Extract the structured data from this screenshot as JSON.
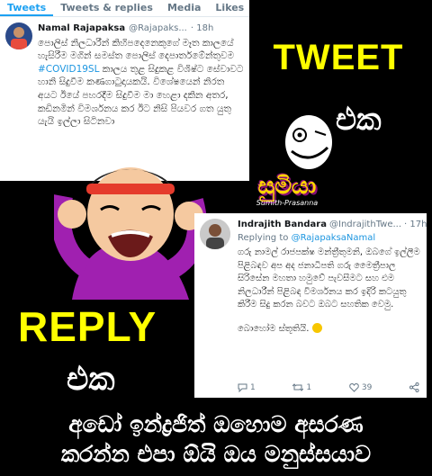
{
  "tweet": {
    "tabs": [
      "Tweets",
      "Tweets & replies",
      "Media",
      "Likes"
    ],
    "name": "Namal Rajapaksa",
    "handle": "@Rajapaks...",
    "time": "· 18h",
    "text_before": "පොලිස් නිලධාරීන් කිහිපදෙනෙකුගේ මෑත කාලයේ හැසිරීම මගින් සමස්ත පොලිස් දෙපාර්තමේන්තුවම ",
    "hashtag": "#COVID19SL",
    "text_after": " කාලය තුළ සිදුකළ විශිෂ්ට සේවාවට හානි සිදුවීම කණගාටුදායකයි. විශේෂයෙන් නිරත අයට ඊයේ පහරදීම සිදුවීම මා හෙළා දකින අතර, කඩිනමින් විමර්ශනය කර ඊට නිසි පියවර ගත යුතු යැයි ඉල්ලා සිටිනවා"
  },
  "labels": {
    "tweet_big": "TWEET",
    "eka_top": "එක",
    "badge_main": "සුමියා",
    "badge_sub": "Sumith-Prasanna",
    "reply_big": "REPLY",
    "eka_bottom": "එක"
  },
  "reply": {
    "name": "Indrajith Bandara",
    "handle": "@IndrajithTwe...",
    "time": "· 17h",
    "replying_prefix": "Replying to ",
    "replying_to": "@RajapaksaNamal",
    "text": "ගරු නාමල් රාජපක්ෂ මන්ත්‍රීතුමනි, ඔබගේ ඉල්ලීම පිළිබඳව අප අද ජනාධිපති ගරු මෛත්‍රීපාල සිරිසේන මහතා හමුවේ පැවසීමට සහ එම නිලධාරීන් පිළිබඳ විමර්ශනය කර ඉදිරි කටයුතු කිරීම සිදු කරන බවට ඔබට සහතික වෙමු.",
    "thanks": "බොහෝම ස්තූතියි.",
    "actions": {
      "reply_count": "1",
      "retweet_count": "1",
      "like_count": "39"
    }
  },
  "caption": {
    "line1": "අඩෝ ඉන්ද්‍රජිත් ඔහොම අසරණ",
    "line2": "කරන්න එපා ඕයි ඔය මනුස්සයාව"
  },
  "colors": {
    "accent_yellow": "#ffff00",
    "twitter_blue": "#1da1f2",
    "link_blue": "#1b95e0",
    "badge_purple": "#8a0e7a"
  }
}
